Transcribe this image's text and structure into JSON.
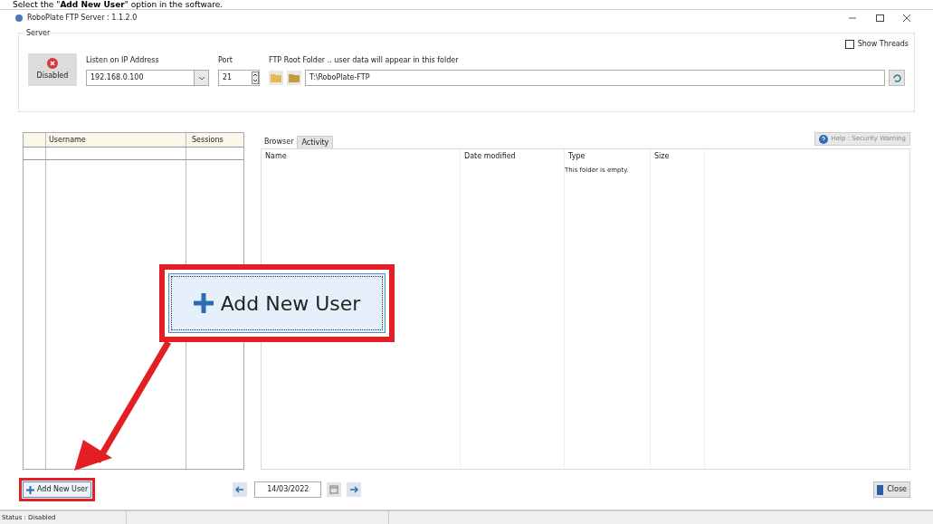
{
  "caption": "Select the \"**Add New User**\" option in the software.",
  "window": {
    "title": "RoboPlate FTP Server : 1.1.2.0"
  },
  "server": {
    "legend": "Server",
    "toggle_label": "Disabled",
    "ip_label": "Listen on IP Address",
    "ip_value": "192.168.0.100",
    "port_label": "Port",
    "port_value": "21",
    "folder_label": "FTP Root Folder .. user data will appear in this folder",
    "folder_value": "T:\\RoboPlate-FTP",
    "show_threads": {
      "label": "Show Threads",
      "checked": false
    }
  },
  "users_table": {
    "columns": [
      "Username",
      "Sessions"
    ]
  },
  "tabs": [
    {
      "label": "Browser",
      "selected": true
    },
    {
      "label": "Activity",
      "selected": false
    }
  ],
  "help_button": "Help : Security Warning",
  "browser": {
    "columns": [
      "Name",
      "Date modified",
      "Type",
      "Size"
    ],
    "empty_message": "This folder is empty."
  },
  "date_field": "14/03/2022",
  "add_user_button": "Add New User",
  "close_button": "Close",
  "callout": {
    "label": "Add New User"
  },
  "status_bar": [
    "Status : Disabled"
  ]
}
